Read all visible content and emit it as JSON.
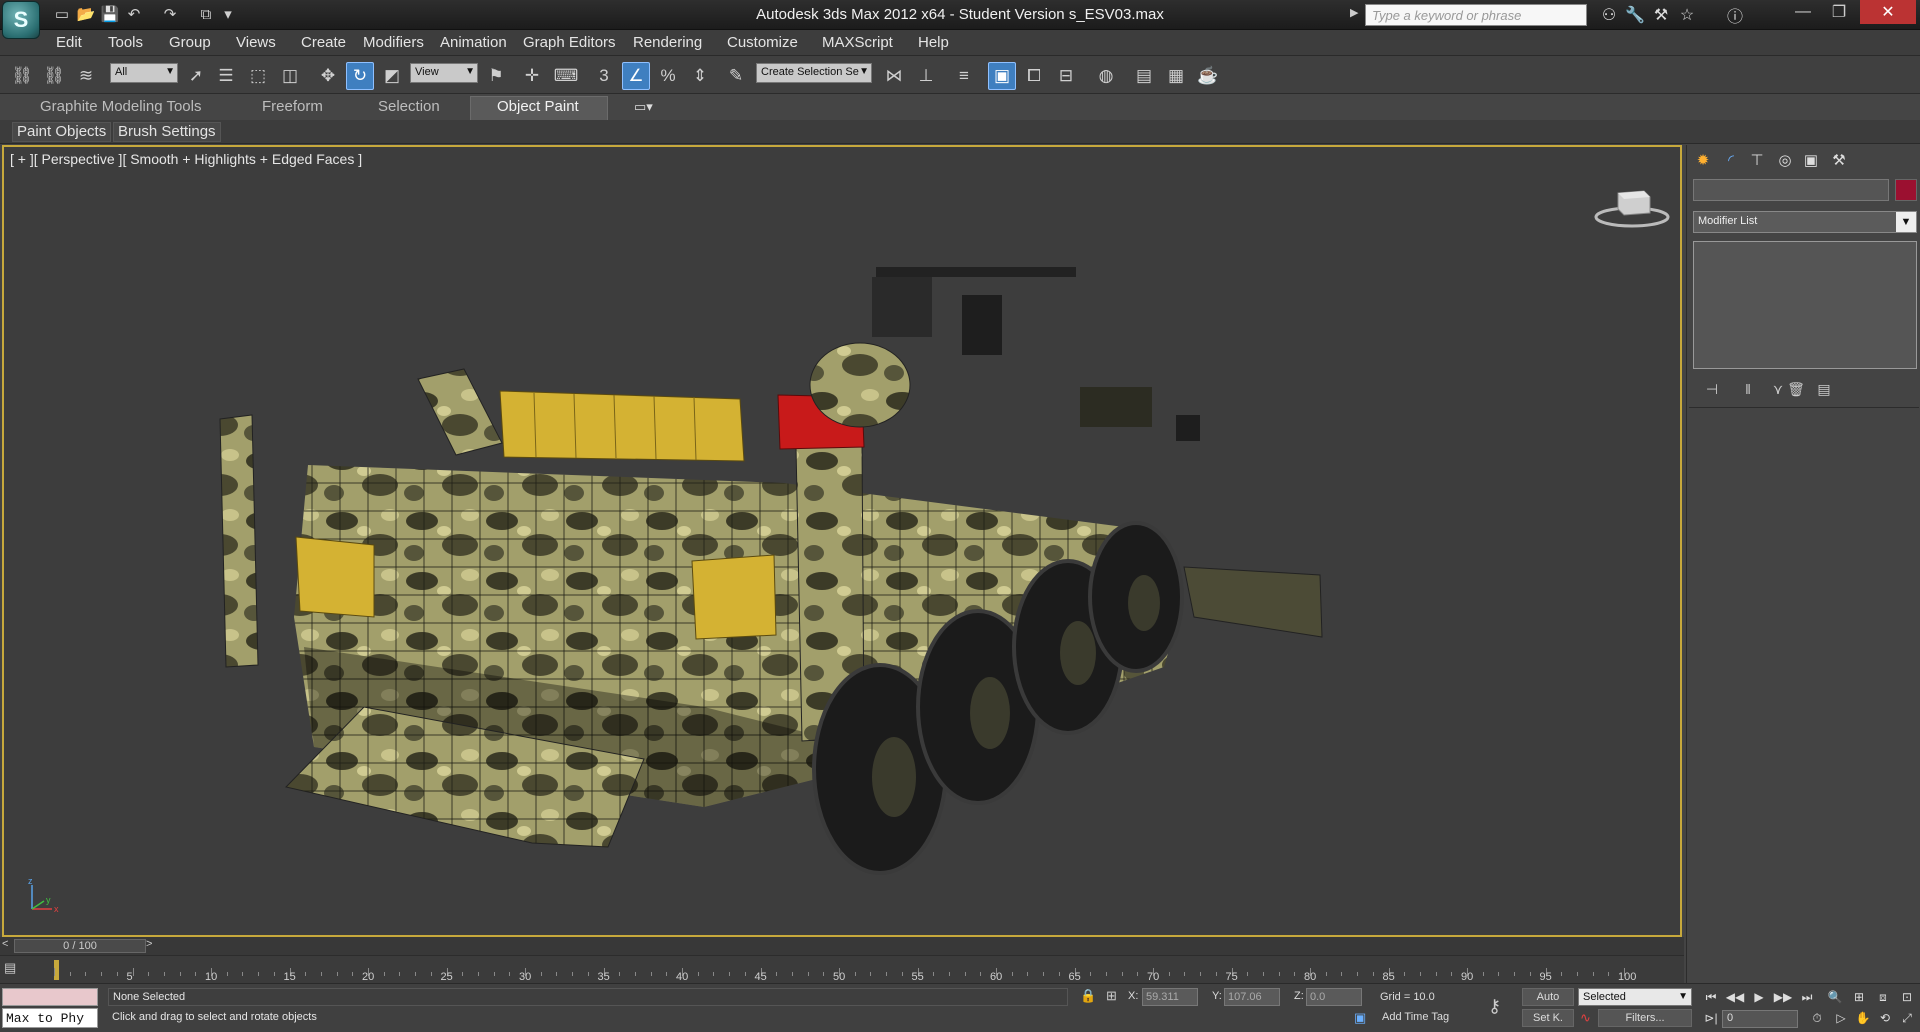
{
  "window": {
    "title": "Autodesk 3ds Max  2012 x64  - Student Version    s_ESV03.max",
    "search_placeholder": "Type a keyword or phrase"
  },
  "menu": [
    "Edit",
    "Tools",
    "Group",
    "Views",
    "Create",
    "Modifiers",
    "Animation",
    "Graph Editors",
    "Rendering",
    "Customize",
    "MAXScript",
    "Help"
  ],
  "toolbar": {
    "selection_filter": "All",
    "ref_coord": "View",
    "named_selection": "Create Selection Se",
    "snap_label": "3",
    "percent_label": "%"
  },
  "ribbon": {
    "tabs": [
      "Graphite Modeling Tools",
      "Freeform",
      "Selection",
      "Object Paint"
    ],
    "active_tab": "Object Paint",
    "panels": [
      "Paint Objects",
      "Brush Settings"
    ]
  },
  "viewport": {
    "label": "[ + ][ Perspective ][ Smooth + Highlights + Edged Faces ]",
    "axis_x": "x",
    "axis_y": "y",
    "axis_z": "z"
  },
  "command_panel": {
    "modifier_list": "Modifier List",
    "object_color": "#9b1030"
  },
  "timeline": {
    "frame_display": "0 / 100",
    "ticks": [
      "5",
      "10",
      "15",
      "20",
      "25",
      "30",
      "35",
      "40",
      "45",
      "50",
      "55",
      "60",
      "65",
      "70",
      "75",
      "80",
      "85",
      "90",
      "95",
      "100"
    ]
  },
  "status": {
    "maxscript": "Max to Phy",
    "selection": "None Selected",
    "prompt": "Click and drag to select and rotate objects",
    "x_label": "X:",
    "x_value": "59.311",
    "y_label": "Y:",
    "y_value": "107.06",
    "z_label": "Z:",
    "z_value": "0.0",
    "grid": "Grid = 10.0",
    "add_time_tag": "Add Time Tag",
    "auto_key": "Auto",
    "set_key": "Set K.",
    "key_mode": "Selected",
    "filters": "Filters...",
    "current_frame": "0"
  },
  "colors": {
    "viewport_border": "#c7a93c",
    "active_tool": "#3f7fc0",
    "camo_light": "#9c9a66",
    "camo_dark": "#3a3a26",
    "jerrycan": "#d4b233",
    "red_box": "#c81a1a"
  }
}
